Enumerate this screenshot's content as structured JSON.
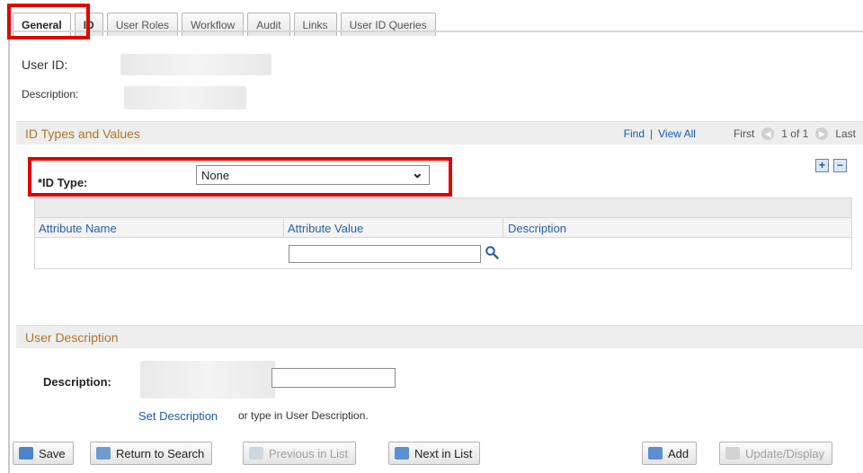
{
  "tabs": [
    {
      "label": "General"
    },
    {
      "label": "ID"
    },
    {
      "label": "User Roles"
    },
    {
      "label": "Workflow"
    },
    {
      "label": "Audit"
    },
    {
      "label": "Links"
    },
    {
      "label": "User ID Queries"
    }
  ],
  "header": {
    "user_id_label": "User ID:",
    "description_label": "Description:"
  },
  "id_types": {
    "section_title": "ID Types and Values",
    "find_label": "Find",
    "separator": "|",
    "view_all_label": "View All",
    "first_label": "First",
    "page_info": "1 of 1",
    "last_label": "Last",
    "id_type_label": "*ID Type:",
    "id_type_value": "None",
    "add_row": "+",
    "remove_row": "−",
    "columns": [
      "Attribute Name",
      "Attribute Value",
      "Description"
    ]
  },
  "user_description": {
    "section_title": "User Description",
    "description_label": "Description:",
    "set_description_link": "Set Description",
    "hint_text": "or type in User Description."
  },
  "toolbar": {
    "save": "Save",
    "return_to_search": "Return to Search",
    "previous_in_list": "Previous in List",
    "next_in_list": "Next in List",
    "add": "Add",
    "update_display": "Update/Display"
  },
  "colors": {
    "highlight": "#e00000",
    "section_title": "#b0742a",
    "link": "#1a5aa8"
  },
  "icons": {
    "lookup": "magnifier-icon",
    "save": "save-icon",
    "return": "return-to-search-icon",
    "previous": "previous-in-list-icon",
    "next": "next-in-list-icon",
    "add": "add-icon",
    "update": "update-display-icon"
  }
}
